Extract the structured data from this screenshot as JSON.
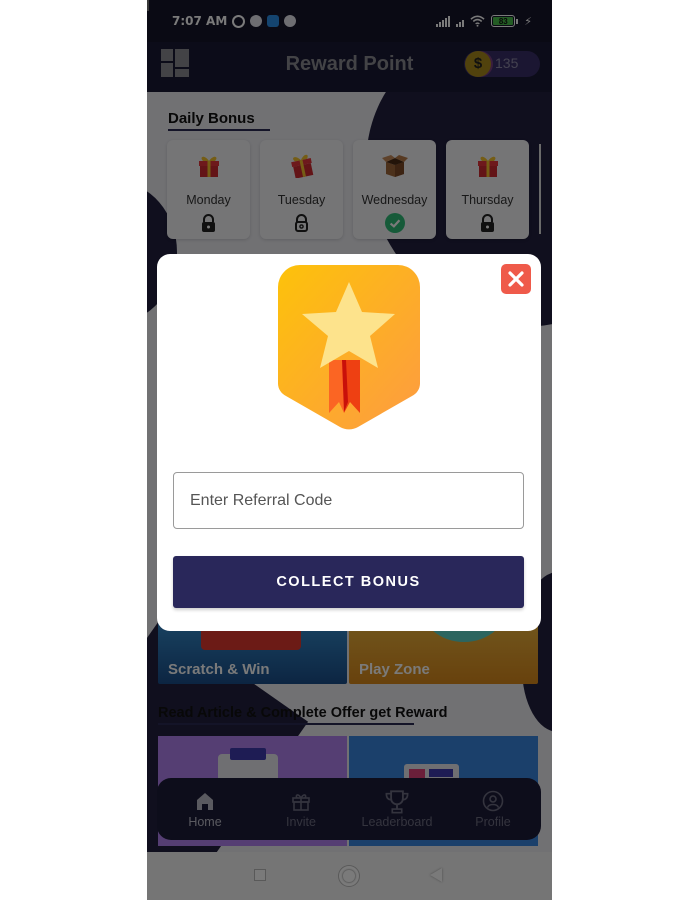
{
  "status_bar": {
    "time": "7:07 AM",
    "battery_level": "83",
    "left_icons": [
      "alarm-icon",
      "app-notification-icon",
      "screen-share-icon",
      "app-notification-icon"
    ],
    "right_icons": [
      "signal-icon",
      "signal-icon",
      "wifi-icon",
      "battery-icon",
      "charging-icon"
    ]
  },
  "header": {
    "title": "Reward Point",
    "coin_symbol": "$",
    "points": "135",
    "menu_icon": "grid-menu-icon"
  },
  "daily_bonus": {
    "title": "Daily Bonus",
    "days": [
      {
        "name": "Monday",
        "icon": "gift-icon",
        "status": "locked"
      },
      {
        "name": "Tuesday",
        "icon": "gift-open-icon",
        "status": "unlocked"
      },
      {
        "name": "Wednesday",
        "icon": "open-box-icon",
        "status": "collected"
      },
      {
        "name": "Thursday",
        "icon": "gift-icon",
        "status": "locked"
      }
    ]
  },
  "games": [
    {
      "label": "Scratch & Win"
    },
    {
      "label": "Play Zone"
    }
  ],
  "offers": {
    "title": "Read Article & Complete Offer get Reward"
  },
  "bottom_nav": {
    "items": [
      {
        "label": "Home",
        "icon": "home-icon",
        "active": true
      },
      {
        "label": "Invite",
        "icon": "gift-icon",
        "active": false
      },
      {
        "label": "Leaderboard",
        "icon": "trophy-icon",
        "active": false
      },
      {
        "label": "Profile",
        "icon": "profile-icon",
        "active": false
      }
    ]
  },
  "modal": {
    "badge_icon": "star-ribbon-badge-icon",
    "referral_placeholder": "Enter Referral Code",
    "referral_value": "",
    "collect_label": "COLLECT BONUS",
    "colors": {
      "button": "#29275a",
      "close": "#ef5a4a",
      "badge_top": "#fcc30c",
      "badge_bottom": "#fd9c40"
    }
  }
}
